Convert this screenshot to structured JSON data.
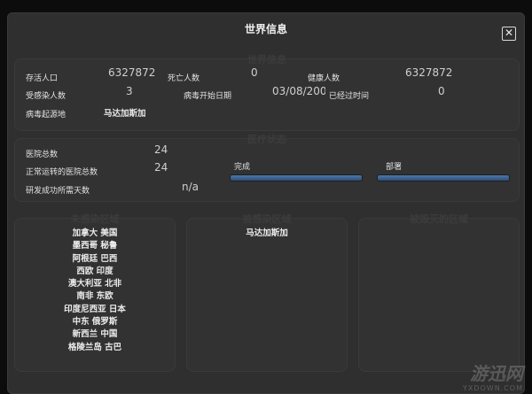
{
  "dialog": {
    "title": "世界信息",
    "close_label": "✕"
  },
  "world": {
    "title": "世界信息",
    "alive_label": "存活人口",
    "alive_value": "6327872",
    "dead_label": "死亡人数",
    "dead_value": "0",
    "healthy_label": "健康人数",
    "healthy_value": "6327872",
    "infected_label": "受感染人数",
    "infected_value": "3",
    "start_label": "病毒开始日期",
    "start_value": "03/08/200",
    "elapsed_label": "已经过时间",
    "elapsed_value": "0",
    "origin_label": "病毒起源地",
    "origin_value": "马达加斯加"
  },
  "medical": {
    "title": "医疗状态",
    "hospitals_label": "医院总数",
    "hospitals_value": "24",
    "working_label": "正常运转的医院总数",
    "working_value": "24",
    "research_label": "研发成功所需天数",
    "research_value": "n/a",
    "complete_label": "完成",
    "complete_progress": 1.0,
    "deploy_label": "部署",
    "deploy_progress": 1.0
  },
  "regions": {
    "healthy_title": "未感染区域",
    "infected_title": "被感染区域",
    "destroyed_title": "被毁灭的区域",
    "healthy_list": [
      "加拿大  美国",
      "墨西哥  秘鲁",
      "阿根廷  巴西",
      "西欧  印度",
      "澳大利亚  北非",
      "南非  东欧",
      "印度尼西亚  日本",
      "中东  俄罗斯",
      "新西兰  中国",
      "格陵兰岛  古巴"
    ],
    "infected_list": [
      "马达加斯加"
    ],
    "destroyed_list": []
  },
  "watermark": {
    "brand": "游迅网",
    "url": "YXDOWN.COM"
  }
}
